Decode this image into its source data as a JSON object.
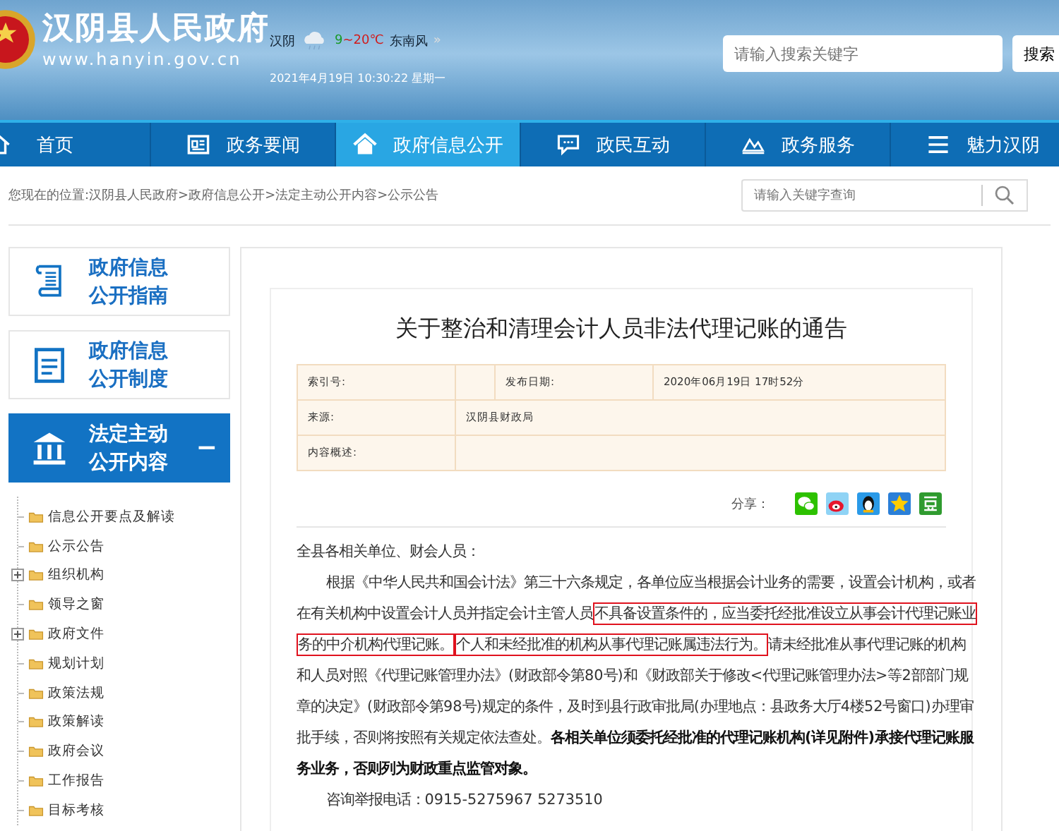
{
  "header": {
    "site_title": "汉阴县人民政府",
    "site_url": "www.hanyin.gov.cn",
    "weather": {
      "place": "汉阴",
      "low": "9",
      "high": "~20℃",
      "wind": "东南风",
      "more": "»"
    },
    "datetime": "2021年4月19日 10:30:22 星期一",
    "search": {
      "placeholder": "请输入搜索关键字",
      "button": "搜索"
    }
  },
  "nav": [
    {
      "label": "首页",
      "selected": false
    },
    {
      "label": "政务要闻",
      "selected": false
    },
    {
      "label": "政府信息公开",
      "selected": true
    },
    {
      "label": "政民互动",
      "selected": false
    },
    {
      "label": "政务服务",
      "selected": false
    },
    {
      "label": "魅力汉阴",
      "selected": false
    }
  ],
  "breadcrumb": "您现在的位置:汉阴县人民政府>政府信息公开>法定主动公开内容>公示公告",
  "page_search": {
    "placeholder": "请输入关键字查询"
  },
  "sidebar": {
    "cards": [
      {
        "line1": "政府信息",
        "line2": "公开指南",
        "selected": false
      },
      {
        "line1": "政府信息",
        "line2": "公开制度",
        "selected": false
      },
      {
        "line1": "法定主动",
        "line2": "公开内容",
        "selected": true,
        "toggle": "−"
      }
    ],
    "tree": [
      {
        "label": "信息公开要点及解读",
        "kind": "leaf"
      },
      {
        "label": "公示公告",
        "kind": "leaf"
      },
      {
        "label": "组织机构",
        "kind": "branch",
        "expanded": false
      },
      {
        "label": "领导之窗",
        "kind": "leaf"
      },
      {
        "label": "政府文件",
        "kind": "branch",
        "expanded": false
      },
      {
        "label": "规划计划",
        "kind": "leaf"
      },
      {
        "label": "政策法规",
        "kind": "leaf"
      },
      {
        "label": "政策解读",
        "kind": "leaf"
      },
      {
        "label": "政府会议",
        "kind": "leaf"
      },
      {
        "label": "工作报告",
        "kind": "leaf"
      },
      {
        "label": "目标考核",
        "kind": "leaf"
      }
    ]
  },
  "article": {
    "title": "关于整治和清理会计人员非法代理记账的通告",
    "meta": {
      "index_label": "索引号:",
      "date_label": "发布日期:",
      "date": "2020年06月19日 17时52分",
      "source_label": "来源:",
      "source": "汉阴县财政局",
      "summary_label": "内容概述:"
    },
    "share_label": "分享：",
    "salutation": "全县各相关单位、财会人员：",
    "paragraph": [
      {
        "text": "根据《中华人民共和国会计法》第三十六条规定，各单位应当根据会计业务的需要，设置会计机构，或者在有关机构中设置会计人员并指定会计主管人员",
        "kind": "plain"
      },
      {
        "text": "不具备设置条件的，应当委托经批准设立从事会计代理记账业务的中介机构代理记账。",
        "kind": "boxed"
      },
      {
        "text": "个人和未经批准的机构从事代理记账属违法行为。",
        "kind": "boxed"
      },
      {
        "text": "请未经批准从事代理记账的机构和人员对照《代理记账管理办法》(财政部令第80号)和《财政部关于修改<代理记账管理办法>等2部部门规章的决定》(财政部令第98号)规定的条件，及时到县行政审批局(办理地点：县政务大厅4楼52号窗口)办理审批手续，否则将按照有关规定依法查处。",
        "kind": "plain"
      },
      {
        "text": "各相关单位须委托经批准的代理记账机构(详见附件)承接代理记账服务业务，否则列为财政重点监管对象。",
        "kind": "bold"
      }
    ],
    "contact": "咨询举报电话：0915-5275967 5273510"
  }
}
